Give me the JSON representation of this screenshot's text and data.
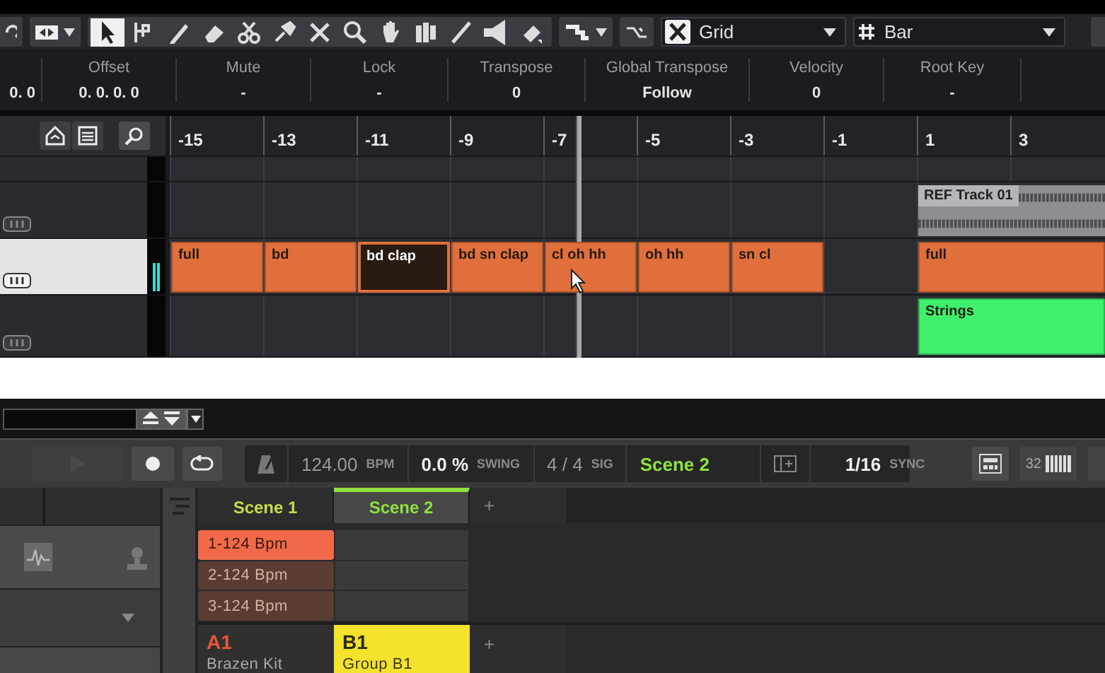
{
  "toolbar": {
    "tools": [
      {
        "kind": "pointer",
        "selected": true
      },
      {
        "kind": "range",
        "selected": false
      },
      {
        "kind": "pencil",
        "selected": false
      },
      {
        "kind": "eraser",
        "selected": false
      },
      {
        "kind": "scissors",
        "selected": false
      },
      {
        "kind": "glue",
        "selected": false
      },
      {
        "kind": "mute",
        "selected": false
      },
      {
        "kind": "zoom",
        "selected": false
      },
      {
        "kind": "hand",
        "selected": false
      },
      {
        "kind": "comp",
        "selected": false
      },
      {
        "kind": "line",
        "selected": false
      },
      {
        "kind": "speaker",
        "selected": false
      },
      {
        "kind": "color",
        "selected": false
      }
    ],
    "snap_type": "Grid",
    "quantize": "Bar"
  },
  "info_line": [
    {
      "value": "0. 0"
    },
    {
      "label": "Offset",
      "value": "0. 0. 0. 0"
    },
    {
      "label": "Mute",
      "value": "-"
    },
    {
      "label": "Lock",
      "value": "-"
    },
    {
      "label": "Transpose",
      "value": "0"
    },
    {
      "label": "Global Transpose",
      "value": "Follow"
    },
    {
      "label": "Velocity",
      "value": "0"
    },
    {
      "label": "Root Key",
      "value": "-"
    }
  ],
  "ruler": [
    "-15",
    "-13",
    "-11",
    "-9",
    "-7",
    "-5",
    "-3",
    "-1",
    "1",
    "3"
  ],
  "tracks": [
    {
      "selected": false
    },
    {
      "selected": false,
      "cells": [
        {
          "kind": "empty"
        },
        {
          "kind": "empty"
        },
        {
          "kind": "empty"
        },
        {
          "kind": "empty"
        },
        {
          "kind": "empty"
        },
        {
          "kind": "empty"
        },
        {
          "kind": "empty"
        },
        {
          "kind": "empty"
        },
        {
          "kind": "audio",
          "label": "REF Track 01"
        }
      ]
    },
    {
      "selected": true,
      "level": 0.5,
      "cells": [
        {
          "kind": "midi",
          "label": "full",
          "color": "#e06f3b",
          "selected": false
        },
        {
          "kind": "midi",
          "label": "bd",
          "color": "#e06f3b",
          "selected": false
        },
        {
          "kind": "midi",
          "label": "bd clap",
          "color": "#e06f3b",
          "selected": true
        },
        {
          "kind": "midi",
          "label": "bd sn clap",
          "color": "#e06f3b",
          "selected": false
        },
        {
          "kind": "midi",
          "label": "cl oh hh",
          "color": "#e06f3b",
          "selected": false
        },
        {
          "kind": "midi",
          "label": "oh hh",
          "color": "#e06f3b",
          "selected": false
        },
        {
          "kind": "midi",
          "label": "sn cl",
          "color": "#e06f3b",
          "selected": false
        },
        {
          "kind": "empty"
        },
        {
          "kind": "midi",
          "label": "full",
          "color": "#e06f3b",
          "selected": false
        }
      ]
    },
    {
      "selected": false,
      "cells": [
        {
          "kind": "empty"
        },
        {
          "kind": "empty"
        },
        {
          "kind": "empty"
        },
        {
          "kind": "empty"
        },
        {
          "kind": "empty"
        },
        {
          "kind": "empty"
        },
        {
          "kind": "empty"
        },
        {
          "kind": "empty"
        },
        {
          "kind": "midi",
          "label": "Strings",
          "color": "#3ef06b",
          "selected": false
        }
      ]
    }
  ],
  "transport": {
    "tempo": {
      "value": "124.00",
      "unit": "BPM"
    },
    "swing": {
      "value": "0.0 %",
      "unit": "SWING"
    },
    "signature": {
      "value": "4 / 4",
      "unit": "SIG"
    },
    "scene": "Scene 2",
    "step": {
      "value": "1/16",
      "unit": "SYNC"
    },
    "keyboard": "32"
  },
  "scenes": [
    {
      "label": "Scene 1",
      "selected": false
    },
    {
      "label": "Scene 2",
      "selected": true
    }
  ],
  "add_scene": "+",
  "patterns": [
    {
      "label": "1-124 Bpm",
      "selected": true
    },
    {
      "label": "2-124 Bpm",
      "selected": false
    },
    {
      "label": "3-124 Bpm",
      "selected": false
    }
  ],
  "groups": [
    {
      "label": "A1",
      "name": "Brazen Kit",
      "selected": false
    },
    {
      "label": "B1",
      "name": "Group B1",
      "selected": true
    }
  ],
  "add_group": "+"
}
